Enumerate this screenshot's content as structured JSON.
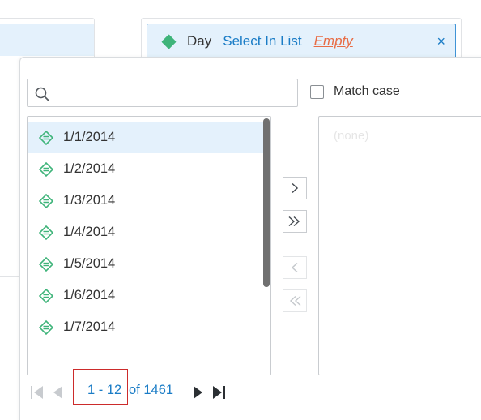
{
  "colors": {
    "accent": "#1a7cc6",
    "selected_bg": "#e4f1fc",
    "diamond_green": "#3fb47a",
    "empty_orange": "#e86c45",
    "highlight_red": "#cc2b2b"
  },
  "filter": {
    "field": "Day",
    "operator": "Select In List",
    "value": "Empty",
    "close_icon": "close-icon",
    "close_glyph": "×"
  },
  "search": {
    "value": "",
    "placeholder": "",
    "icon": "search-icon"
  },
  "match_case": {
    "label": "Match case",
    "checked": false
  },
  "available_list": {
    "items": [
      {
        "label": "1/1/2014",
        "selected": true
      },
      {
        "label": "1/2/2014",
        "selected": false
      },
      {
        "label": "1/3/2014",
        "selected": false
      },
      {
        "label": "1/4/2014",
        "selected": false
      },
      {
        "label": "1/5/2014",
        "selected": false
      },
      {
        "label": "1/6/2014",
        "selected": false
      },
      {
        "label": "1/7/2014",
        "selected": false
      }
    ]
  },
  "selected_list": {
    "empty_text": "(none)"
  },
  "move_buttons": [
    {
      "icon": "chevron-right-icon",
      "enabled": true
    },
    {
      "icon": "double-chevron-right-icon",
      "enabled": true
    },
    {
      "icon": "chevron-left-icon",
      "enabled": false
    },
    {
      "icon": "double-chevron-left-icon",
      "enabled": false
    }
  ],
  "pager": {
    "range": "1 - 12",
    "total": "of 1461",
    "first_icon": "first-page-icon",
    "prev_icon": "previous-page-icon",
    "next_icon": "next-page-icon",
    "last_icon": "last-page-icon"
  }
}
